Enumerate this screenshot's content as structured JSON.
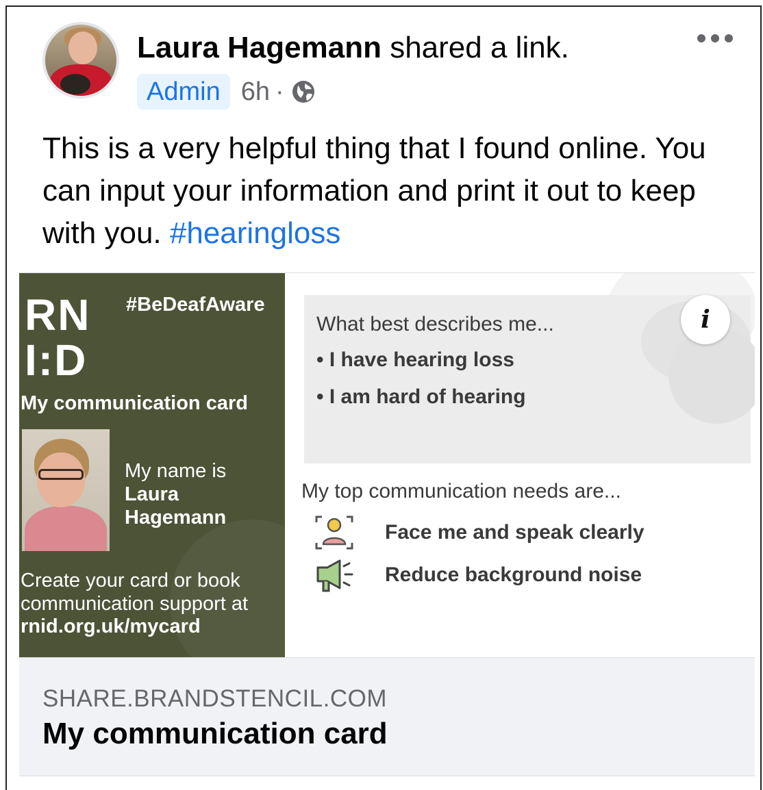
{
  "post": {
    "author_name": "Laura Hagemann",
    "action_text": " shared a link.",
    "badge": "Admin",
    "time": "6h",
    "separator": "·",
    "body_text": "This is a very helpful thing that I found online. You can input your information and print it out to keep with you. ",
    "hashtag": "#hearingloss",
    "more_icon": "more-horizontal-icon",
    "audience_icon": "globe-icon"
  },
  "preview": {
    "logo_text": "RN\nI:D",
    "campaign_tag": "#BeDeafAware",
    "card_title": "My communication card",
    "name_intro": "My name is",
    "name_value": "Laura Hagemann",
    "create_text": "Create your card or book communication support at",
    "card_url": "rnid.org.uk/mycard",
    "describes_title": "What best describes me...",
    "describes_items": [
      "• I have hearing loss",
      "• I am hard of hearing"
    ],
    "needs_title": "My top communication needs are...",
    "needs": [
      {
        "label": "Face me and speak clearly",
        "icon": "face-frame-icon"
      },
      {
        "label": "Reduce background noise",
        "icon": "megaphone-icon"
      }
    ],
    "info_glyph": "i"
  },
  "link": {
    "domain": "SHARE.BRANDSTENCIL.COM",
    "title": "My communication card"
  },
  "colors": {
    "brand_blue": "#1b74e4",
    "card_green": "#4d5337",
    "secondary_text": "#65676b",
    "footer_bg": "#f0f2f5"
  }
}
